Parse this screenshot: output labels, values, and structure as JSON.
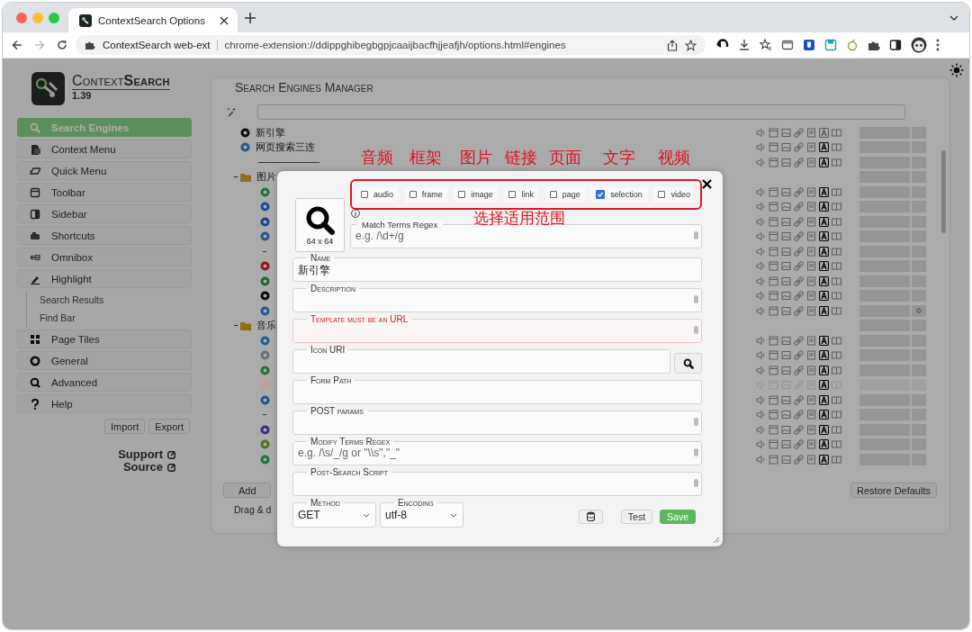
{
  "browser": {
    "tabs": [
      {
        "title": "ContextSearch Options",
        "selected": true
      }
    ],
    "address": {
      "extension_label": "ContextSearch web-ext",
      "url": "chrome-extension://ddippghibegbgpjcaaijbacfhjjeafjh/options.html#engines"
    }
  },
  "sidebar": {
    "app_title": "Context**Search**",
    "version": "1.39",
    "items": [
      {
        "label": "Search Engines",
        "selected": true
      },
      {
        "label": "Context Menu",
        "selected": false
      },
      {
        "label": "Quick Menu",
        "selected": false
      },
      {
        "label": "Toolbar",
        "selected": false
      },
      {
        "label": "Sidebar",
        "selected": false
      },
      {
        "label": "Shortcuts",
        "selected": false
      },
      {
        "label": "Omnibox",
        "selected": false
      },
      {
        "label": "Highlight",
        "selected": false,
        "children": [
          {
            "label": "Search Results",
            "selected": false
          },
          {
            "label": "Find Bar",
            "selected": false
          }
        ]
      },
      {
        "label": "Page Tiles",
        "selected": false
      },
      {
        "label": "General",
        "selected": false
      },
      {
        "label": "Advanced",
        "selected": false
      },
      {
        "label": "Help",
        "selected": false
      }
    ],
    "buttons": [
      "Import",
      "Export"
    ],
    "links": [
      "Support",
      "Source"
    ]
  },
  "manager": {
    "title": "Search Engines Manager",
    "rows": [
      {
        "kind": "engine",
        "name": "新引擎",
        "color": "#0c0c0c",
        "selection": false,
        "disabled": false
      },
      {
        "kind": "engine",
        "name": "网页搜索三连",
        "color": "#285690",
        "selection": true,
        "disabled": false
      },
      {
        "kind": "separator",
        "selection": true,
        "disabled": false
      },
      {
        "kind": "folder",
        "name": "图片",
        "expanded": true,
        "children": [
          {
            "kind": "engine",
            "color": "#237238",
            "selection": true,
            "disabled": false
          },
          {
            "kind": "engine",
            "color": "#124e9e",
            "selection": true,
            "disabled": false
          },
          {
            "kind": "engine",
            "color": "#1f4192",
            "selection": true,
            "disabled": false
          },
          {
            "kind": "engine",
            "color": "#285690",
            "selection": true,
            "disabled": false
          },
          {
            "kind": "separator",
            "selection": true,
            "disabled": false
          },
          {
            "kind": "engine",
            "color": "#8f181d",
            "selection": true,
            "disabled": false
          },
          {
            "kind": "engine",
            "color": "#1f6a32",
            "selection": true,
            "disabled": false
          },
          {
            "kind": "engine",
            "color": "#0c0c0c",
            "selection": true,
            "disabled": false
          },
          {
            "kind": "engine",
            "color": "#285690",
            "selection": true,
            "disabled": false,
            "shortcut": "©"
          }
        ]
      },
      {
        "kind": "folder",
        "name": "音乐",
        "expanded": true,
        "children": [
          {
            "kind": "engine",
            "color": "#1d6193",
            "selection": true,
            "disabled": false
          },
          {
            "kind": "engine",
            "color": "#697076",
            "selection": true,
            "disabled": false
          },
          {
            "kind": "engine",
            "color": "#237238",
            "selection": true,
            "disabled": false
          },
          {
            "kind": "engine",
            "color": "#c89a9a",
            "selection": true,
            "disabled": true
          },
          {
            "kind": "engine",
            "color": "#285690",
            "selection": true,
            "disabled": false
          },
          {
            "kind": "separator",
            "selection": true,
            "disabled": false
          },
          {
            "kind": "engine",
            "color": "#3e2b90",
            "selection": true,
            "disabled": false
          },
          {
            "kind": "engine",
            "color": "#567227",
            "selection": true,
            "disabled": false
          },
          {
            "kind": "engine",
            "color": "#15763d",
            "selection": true,
            "disabled": false
          }
        ]
      }
    ],
    "add_button": "Add",
    "hint": "Drag & d",
    "restore_button": "Restore Defaults"
  },
  "modal": {
    "contexts": [
      {
        "label": "audio",
        "checked": false
      },
      {
        "label": "frame",
        "checked": false
      },
      {
        "label": "image",
        "checked": false
      },
      {
        "label": "link",
        "checked": false
      },
      {
        "label": "page",
        "checked": false
      },
      {
        "label": "selection",
        "checked": true
      },
      {
        "label": "video",
        "checked": false
      }
    ],
    "icon_size": "64 x 64",
    "match_terms": {
      "label": "Match Terms Regex",
      "placeholder": "e.g. /\\d+/g"
    },
    "fields": [
      {
        "kind": "input",
        "label": "Name",
        "value": "新引擎",
        "error": false
      },
      {
        "kind": "textarea",
        "label": "Description",
        "error": false
      },
      {
        "kind": "textarea",
        "label": "Template must be an URL",
        "error": true
      },
      {
        "kind": "input_search",
        "label": "Icon URI",
        "error": false
      },
      {
        "kind": "input",
        "label": "Form Path",
        "error": false
      },
      {
        "kind": "textarea",
        "label": "POST params",
        "error": false
      },
      {
        "kind": "textarea",
        "label": "Modify Terms Regex",
        "placeholder": "e.g. /\\s/_/g or \"\\\\s\",\"_\"",
        "error": false
      },
      {
        "kind": "textarea",
        "label": "Post-Search Script",
        "error": false
      }
    ],
    "selects": [
      {
        "label": "Method",
        "value": "GET"
      },
      {
        "label": "Encoding",
        "value": "utf-8"
      }
    ],
    "buttons": [
      {
        "kind": "icon"
      },
      {
        "kind": "plain",
        "label": "Test"
      },
      {
        "kind": "primary",
        "label": "Save"
      }
    ]
  },
  "annotations": {
    "labels": [
      "音频",
      "框架",
      "图片",
      "链接",
      "页面",
      "文字",
      "视频"
    ],
    "caption": "选择适用范围"
  }
}
